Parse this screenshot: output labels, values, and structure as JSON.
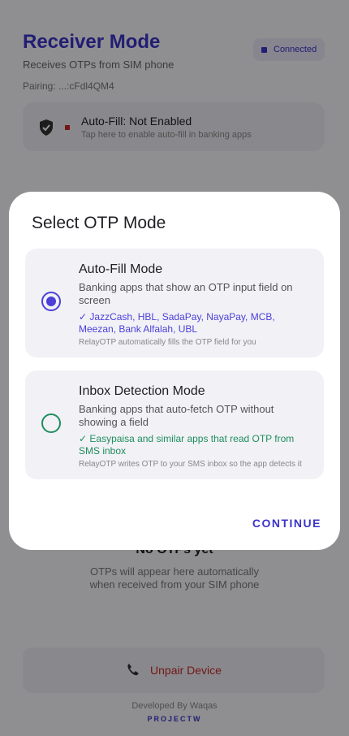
{
  "header": {
    "title": "Receiver Mode",
    "subtitle": "Receives OTPs from SIM phone",
    "pairing": "Pairing: ...:cFdl4QM4",
    "status": "Connected"
  },
  "autofill": {
    "title": "Auto-Fill: Not Enabled",
    "subtitle": "Tap here to enable auto-fill in banking apps"
  },
  "empty": {
    "title": "No OTPs yet",
    "subtitle_line1": "OTPs will appear here automatically",
    "subtitle_line2": "when received from your SIM phone"
  },
  "footer": {
    "unpair": "Unpair Device",
    "developer": "Developed By Waqas",
    "brand": "PROJECTW"
  },
  "dialog": {
    "title": "Select OTP Mode",
    "options": [
      {
        "name": "Auto-Fill Mode",
        "description": "Banking apps that show an OTP input field on screen",
        "apps": "✓ JazzCash, HBL, SadaPay, NayaPay, MCB, Meezan, Bank Alfalah, UBL",
        "note": "RelayOTP automatically fills the OTP field for you",
        "selected": true
      },
      {
        "name": "Inbox Detection Mode",
        "description": "Banking apps that auto-fetch OTP without showing a field",
        "apps": "✓ Easypaisa and similar apps that read OTP from SMS inbox",
        "note": "RelayOTP writes OTP to your SMS inbox so the app detects it",
        "selected": false
      }
    ],
    "continue": "CONTINUE"
  },
  "colors": {
    "accent": "#3b34c7",
    "green": "#1f8e5c",
    "danger": "#c62828"
  }
}
